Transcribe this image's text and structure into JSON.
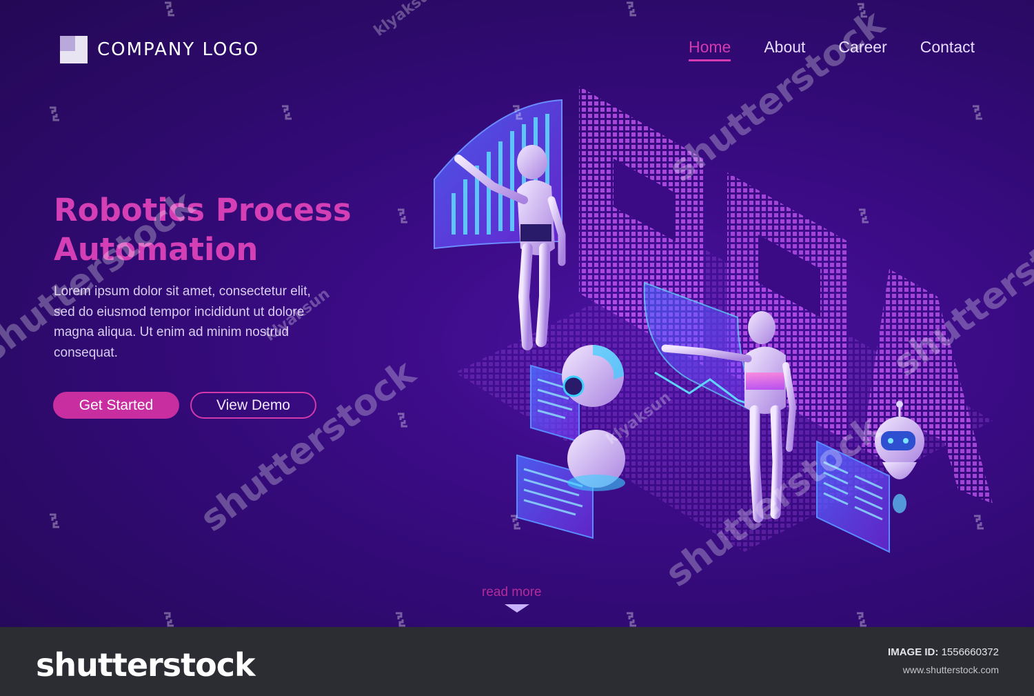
{
  "brand": {
    "logo_text": "COMPANY LOGO"
  },
  "nav": {
    "items": [
      {
        "label": "Home",
        "active": true
      },
      {
        "label": "About",
        "active": false
      },
      {
        "label": "Career",
        "active": false
      },
      {
        "label": "Contact",
        "active": false
      }
    ]
  },
  "hero": {
    "title": "Robotics Process Automation",
    "body": "Lorem ipsum dolor sit amet, consectetur elit, sed do eiusmod tempor incididunt ut dolore magna aliqua. Ut enim ad minim nostrud consequat.",
    "primary_button": "Get Started",
    "secondary_button": "View Demo",
    "read_more": "read more"
  },
  "illustration": {
    "letters": "RPA"
  },
  "watermark": {
    "big_text": "shutterstock",
    "artist": "klyaksun"
  },
  "footer": {
    "brand": "shutterstock",
    "image_id_label": "IMAGE ID:",
    "image_id": "1556660372",
    "url": "www.shutterstock.com"
  },
  "colors": {
    "accent": "#d63ab0",
    "background": "#2c0a6a",
    "footer": "#2b2d33"
  }
}
